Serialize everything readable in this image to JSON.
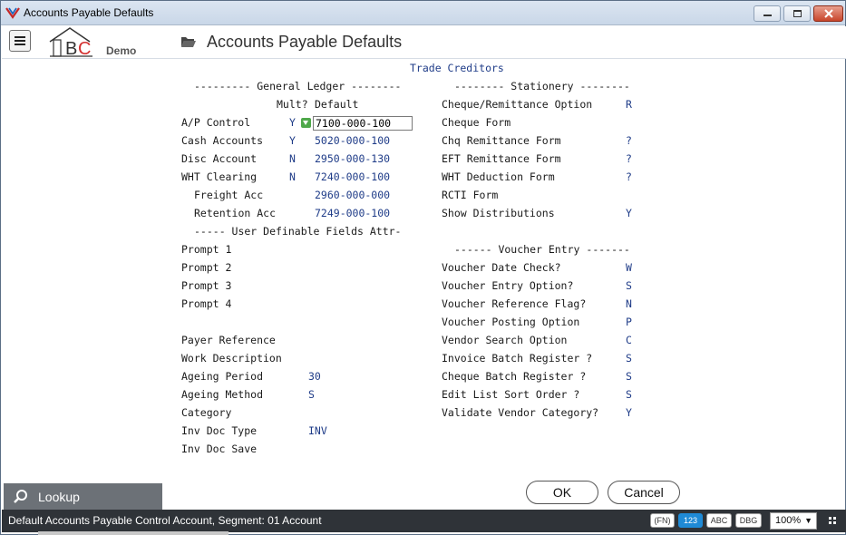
{
  "window": {
    "title": "Accounts Payable Defaults"
  },
  "header": {
    "logo_demo": "Demo",
    "page_title": "Accounts Payable Defaults"
  },
  "form": {
    "section_title": "Trade Creditors",
    "gl_heading": "--------- General Ledger --------",
    "gl_col_mult": "Mult?",
    "gl_col_default": "Default",
    "gl_rows": [
      {
        "label": "A/P Control",
        "mult": "Y",
        "default": "7100-000-100"
      },
      {
        "label": "Cash Accounts",
        "mult": "Y",
        "default": "5020-000-100"
      },
      {
        "label": "Disc Account",
        "mult": "N",
        "default": "2950-000-130"
      },
      {
        "label": "WHT Clearing",
        "mult": "N",
        "default": "7240-000-100"
      },
      {
        "label": "Freight Acc",
        "mult": "",
        "default": "2960-000-000"
      },
      {
        "label": "Retention Acc",
        "mult": "",
        "default": "7249-000-100"
      }
    ],
    "udf_heading": "----- User Definable Fields Attr-",
    "prompts": [
      "Prompt 1",
      "Prompt 2",
      "Prompt 3",
      "Prompt 4"
    ],
    "misc_rows": [
      {
        "label": "Payer Reference",
        "value": ""
      },
      {
        "label": "Work Description",
        "value": ""
      },
      {
        "label": "Ageing Period",
        "value": "30"
      },
      {
        "label": "Ageing Method",
        "value": "S"
      },
      {
        "label": "Category",
        "value": ""
      },
      {
        "label": "Inv Doc Type",
        "value": "INV"
      },
      {
        "label": "Inv Doc Save",
        "value": ""
      }
    ],
    "stationery_heading": "-------- Stationery --------",
    "stationery_rows": [
      {
        "label": "Cheque/Remittance Option",
        "value": "R"
      },
      {
        "label": "Cheque Form",
        "value": ""
      },
      {
        "label": "Chq Remittance Form",
        "value": "?"
      },
      {
        "label": "EFT Remittance Form",
        "value": "?"
      },
      {
        "label": "WHT Deduction Form",
        "value": "?"
      },
      {
        "label": "RCTI Form",
        "value": ""
      },
      {
        "label": "Show Distributions",
        "value": "Y"
      }
    ],
    "voucher_heading": "------ Voucher Entry -------",
    "voucher_rows": [
      {
        "label": "Voucher Date Check?",
        "value": "W"
      },
      {
        "label": "Voucher Entry Option?",
        "value": "S"
      },
      {
        "label": "Voucher Reference Flag?",
        "value": "N"
      },
      {
        "label": "Voucher Posting Option",
        "value": "P"
      },
      {
        "label": "Vendor Search Option",
        "value": "C"
      },
      {
        "label": "Invoice Batch Register ?",
        "value": "S"
      },
      {
        "label": "Cheque Batch Register ?",
        "value": "S"
      },
      {
        "label": "Edit List Sort Order ?",
        "value": "S"
      },
      {
        "label": "Validate Vendor Category?",
        "value": "Y"
      }
    ]
  },
  "buttons": {
    "lookup": "Lookup",
    "ok": "OK",
    "cancel": "Cancel"
  },
  "status": {
    "text": "Default Accounts Payable Control Account,  Segment: 01 Account",
    "chip_fn": "(FN)",
    "chip_123": "123",
    "chip_abc": "ABC",
    "chip_dbg": "DBG",
    "zoom": "100%"
  },
  "colors": {
    "value_text": "#1f3c88",
    "status_bar": "#2f3338",
    "close_button": "#c8452b",
    "active_chip": "#1f8ad6"
  }
}
